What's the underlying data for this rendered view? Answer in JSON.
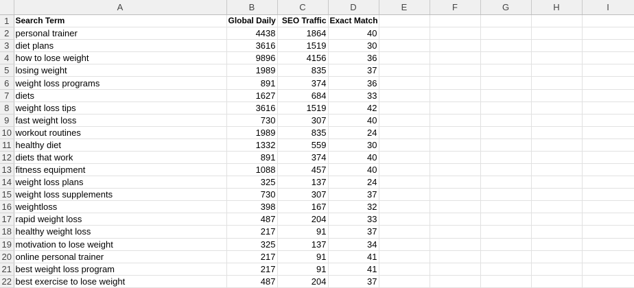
{
  "columns": [
    "A",
    "B",
    "C",
    "D",
    "E",
    "F",
    "G",
    "H",
    "I"
  ],
  "header_row": {
    "row_number": "1",
    "search_term": "Search Term",
    "global_daily": "Global Daily S",
    "seo_traffic": "SEO Traffic",
    "exact_match": "Exact Match"
  },
  "rows": [
    {
      "n": "2",
      "term": "personal trainer",
      "global": "4438",
      "seo": "1864",
      "exact": "40"
    },
    {
      "n": "3",
      "term": "diet plans",
      "global": "3616",
      "seo": "1519",
      "exact": "30"
    },
    {
      "n": "4",
      "term": "how to lose weight",
      "global": "9896",
      "seo": "4156",
      "exact": "36"
    },
    {
      "n": "5",
      "term": "losing weight",
      "global": "1989",
      "seo": "835",
      "exact": "37"
    },
    {
      "n": "6",
      "term": "weight loss programs",
      "global": "891",
      "seo": "374",
      "exact": "36"
    },
    {
      "n": "7",
      "term": "diets",
      "global": "1627",
      "seo": "684",
      "exact": "33"
    },
    {
      "n": "8",
      "term": "weight loss tips",
      "global": "3616",
      "seo": "1519",
      "exact": "42"
    },
    {
      "n": "9",
      "term": "fast weight loss",
      "global": "730",
      "seo": "307",
      "exact": "40"
    },
    {
      "n": "10",
      "term": "workout routines",
      "global": "1989",
      "seo": "835",
      "exact": "24"
    },
    {
      "n": "11",
      "term": "healthy diet",
      "global": "1332",
      "seo": "559",
      "exact": "30"
    },
    {
      "n": "12",
      "term": "diets that work",
      "global": "891",
      "seo": "374",
      "exact": "40"
    },
    {
      "n": "13",
      "term": "fitness equipment",
      "global": "1088",
      "seo": "457",
      "exact": "40"
    },
    {
      "n": "14",
      "term": "weight loss plans",
      "global": "325",
      "seo": "137",
      "exact": "24"
    },
    {
      "n": "15",
      "term": "weight loss supplements",
      "global": "730",
      "seo": "307",
      "exact": "37"
    },
    {
      "n": "16",
      "term": "weightloss",
      "global": "398",
      "seo": "167",
      "exact": "32"
    },
    {
      "n": "17",
      "term": "rapid weight loss",
      "global": "487",
      "seo": "204",
      "exact": "33"
    },
    {
      "n": "18",
      "term": "healthy weight loss",
      "global": "217",
      "seo": "91",
      "exact": "37"
    },
    {
      "n": "19",
      "term": "motivation to lose weight",
      "global": "325",
      "seo": "137",
      "exact": "34"
    },
    {
      "n": "20",
      "term": "online personal trainer",
      "global": "217",
      "seo": "91",
      "exact": "41"
    },
    {
      "n": "21",
      "term": "best weight loss program",
      "global": "217",
      "seo": "91",
      "exact": "41"
    },
    {
      "n": "22",
      "term": "best exercise to lose weight",
      "global": "487",
      "seo": "204",
      "exact": "37"
    }
  ]
}
